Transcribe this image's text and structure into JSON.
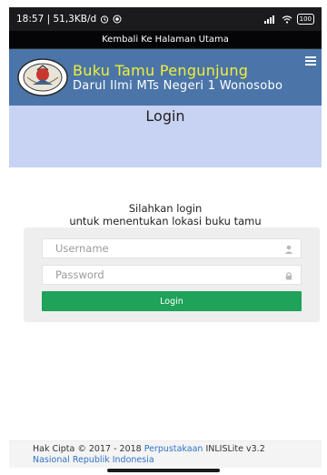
{
  "status_bar": {
    "time_network": "18:57 | 51,3KB/d",
    "battery": "100",
    "icons": [
      "timer-icon",
      "record-icon",
      "signal-icon",
      "wifi-icon",
      "battery-icon"
    ]
  },
  "back_link": {
    "label": "Kembali Ke Halaman Utama"
  },
  "header": {
    "title": "Buku Tamu Pengunjung",
    "subtitle": "Darul Ilmi MTs Negeri 1 Wonosobo",
    "title_color": "#f2ef3a",
    "background": "#4b75a8"
  },
  "hero": {
    "title": "Login",
    "background": "#c8d3f3"
  },
  "login": {
    "prompt_line1": "Silahkan login",
    "prompt_line2": "untuk menentukan lokasi buku tamu",
    "username_placeholder": "Username",
    "password_placeholder": "Password",
    "button_label": "Login",
    "button_color": "#1fa25a"
  },
  "footer": {
    "copyright": "Hak Cipta © 2017 - 2018",
    "link_part1": "Perpustakaan",
    "version": "INLISLite v3.2",
    "link_part2": "Nasional Republik Indonesia"
  }
}
